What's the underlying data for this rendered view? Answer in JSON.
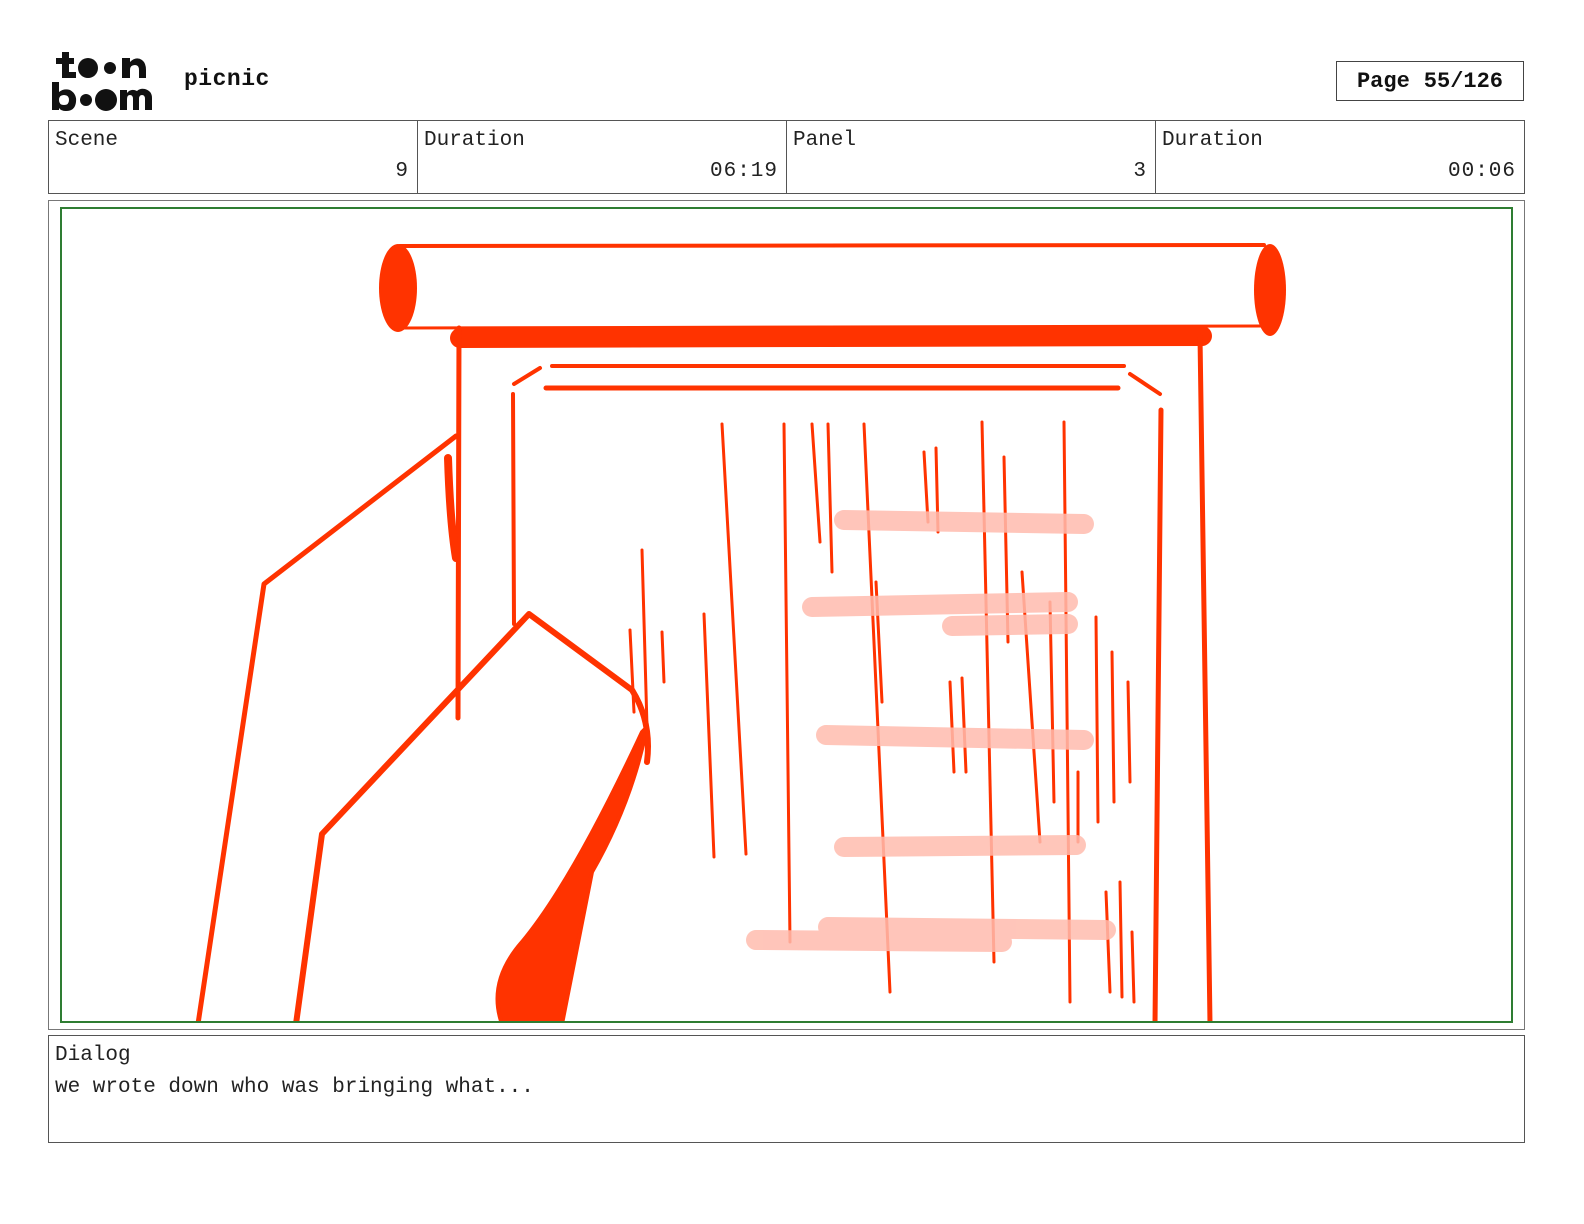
{
  "header": {
    "logo_text": "toon boom",
    "project_title": "picnic",
    "page_label": "Page",
    "page_value": "55/126"
  },
  "info": {
    "scene_label": "Scene",
    "scene_value": "9",
    "scene_duration_label": "Duration",
    "scene_duration_value": "06:19",
    "panel_label": "Panel",
    "panel_value": "3",
    "panel_duration_label": "Duration",
    "panel_duration_value": "00:06"
  },
  "panel_art": {
    "description_icon": "hand-holding-scroll-sketch",
    "stroke_color": "#ff3300",
    "frame_color": "#2e7d32"
  },
  "dialog": {
    "label": "Dialog",
    "text": "we wrote down who was bringing what..."
  }
}
